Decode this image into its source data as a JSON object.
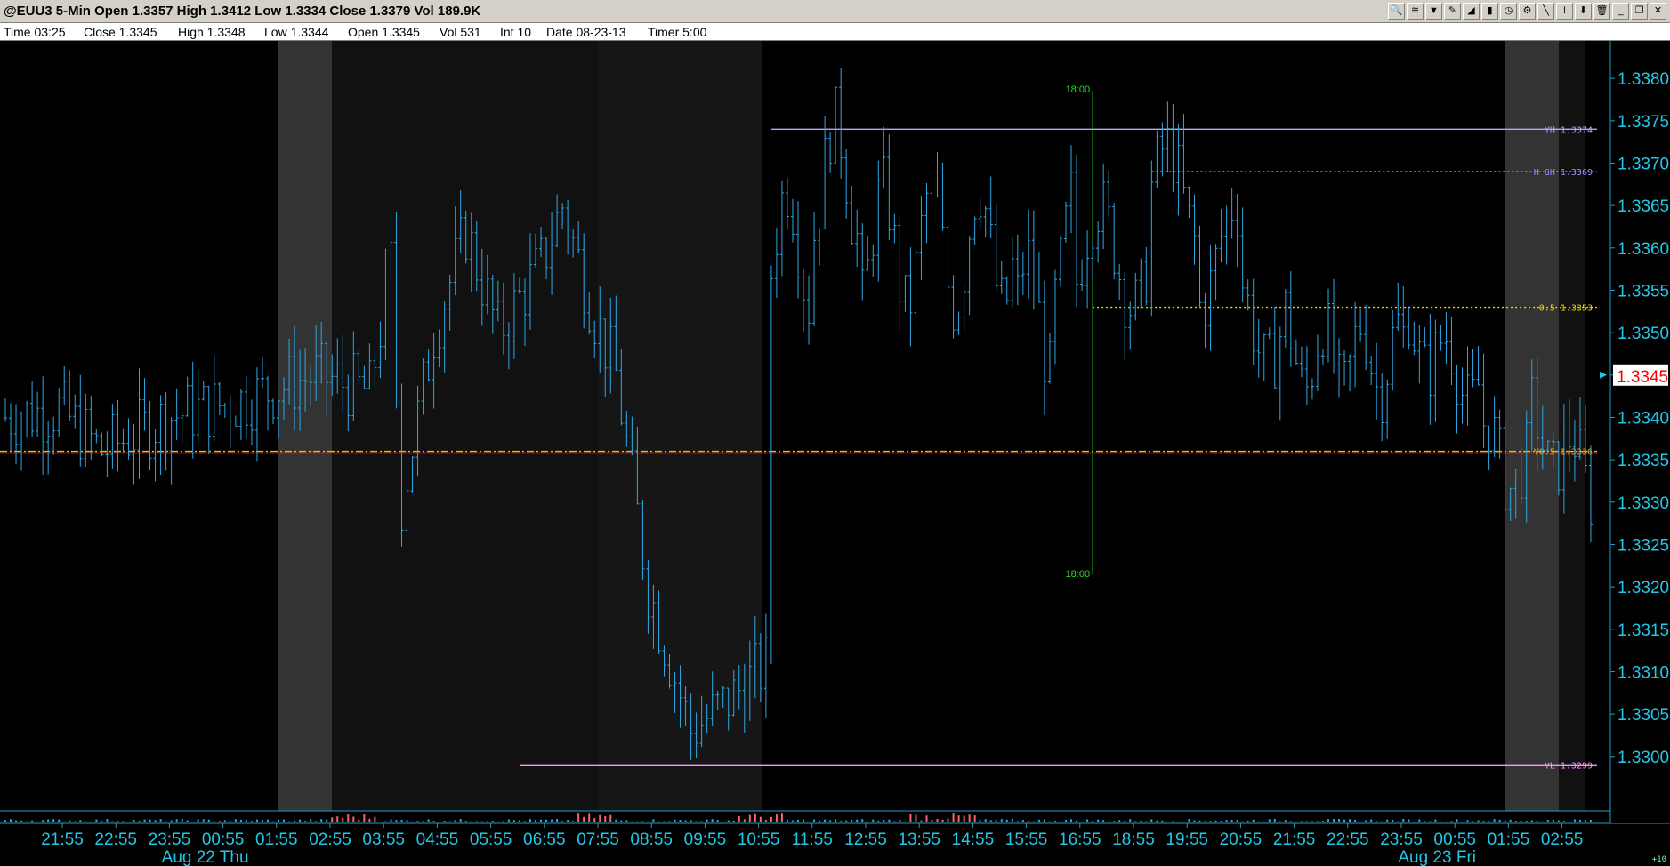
{
  "window": {
    "title": "@EUU3 5-Min Open 1.3357 High 1.3412 Low 1.3334 Close 1.3379 Vol 189.9K",
    "toolbar_icons": [
      "zoom-icon",
      "chart-type-icon",
      "draw-tool-icon",
      "pencil-icon",
      "ruler-icon",
      "bar-icon",
      "clock-icon",
      "settings-icon",
      "wrench-icon",
      "alert-icon",
      "arrow-down-icon",
      "trash-icon",
      "minimize-icon",
      "restore-icon",
      "close-icon"
    ]
  },
  "infobar": {
    "time": "Time 03:25",
    "close": "Close 1.3345",
    "high": "High 1.3348",
    "low": "Low 1.3344",
    "open": "Open 1.3345",
    "vol": "Vol 531",
    "int": "Int 10",
    "date": "Date 08-23-13",
    "timer": "Timer 5:00"
  },
  "corner_label": "+10",
  "chart_data": {
    "type": "bar",
    "ylim": [
      1.3294,
      1.3384
    ],
    "y_ticks": [
      "1.3300",
      "1.3305",
      "1.3310",
      "1.3315",
      "1.3320",
      "1.3325",
      "1.3330",
      "1.3335",
      "1.3340",
      "1.3345",
      "1.3350",
      "1.3355",
      "1.3360",
      "1.3365",
      "1.3370",
      "1.3375",
      "1.3380"
    ],
    "x_ticks": [
      "21:55",
      "22:55",
      "23:55",
      "00:55",
      "01:55",
      "02:55",
      "03:55",
      "04:55",
      "05:55",
      "06:55",
      "07:55",
      "08:55",
      "09:55",
      "10:55",
      "11:55",
      "12:55",
      "13:55",
      "14:55",
      "15:55",
      "16:55",
      "18:55",
      "19:55",
      "20:55",
      "21:55",
      "22:55",
      "23:55",
      "00:55",
      "01:55",
      "02:55"
    ],
    "date_labels": [
      {
        "text": "Aug 22 Thu",
        "at_tick": 3
      },
      {
        "text": "Aug 23 Fri",
        "at_tick": 26
      }
    ],
    "last_price": "1.3345",
    "session_markers": [
      {
        "label": "18:00",
        "at_bar": 203
      }
    ],
    "levels": [
      {
        "label": "YH 1.3374",
        "value": 1.3374,
        "color": "#b4a6ff",
        "style": "solid",
        "from_bar": 143
      },
      {
        "label": "H GH 1.3369",
        "value": 1.3369,
        "color": "#9c8cff",
        "style": "dotted",
        "from_bar": 214
      },
      {
        "label": "0.5 1.3353",
        "value": 1.3353,
        "color": "#e8d800",
        "style": "dotted",
        "from_bar": 203
      },
      {
        "label": "Y0.5 1.3336",
        "value": 1.3336,
        "color": "#e8c000",
        "style": "dashdot",
        "from_bar": 0
      },
      {
        "label": "",
        "value": 1.33358,
        "color": "#ff2020",
        "style": "solid",
        "from_bar": 0
      },
      {
        "label": "YL 1.3299",
        "value": 1.3299,
        "color": "#ff90ff",
        "style": "solid",
        "from_bar": 96
      }
    ],
    "bar_count": 297,
    "keypoints": [
      [
        0,
        1.334
      ],
      [
        10,
        1.3341
      ],
      [
        18,
        1.3336
      ],
      [
        30,
        1.334
      ],
      [
        44,
        1.3342
      ],
      [
        58,
        1.3345
      ],
      [
        68,
        1.3343
      ],
      [
        72,
        1.3358
      ],
      [
        74,
        1.333
      ],
      [
        80,
        1.335
      ],
      [
        86,
        1.3362
      ],
      [
        92,
        1.335
      ],
      [
        100,
        1.3358
      ],
      [
        104,
        1.3365
      ],
      [
        110,
        1.3352
      ],
      [
        114,
        1.3345
      ],
      [
        120,
        1.332
      ],
      [
        128,
        1.3303
      ],
      [
        134,
        1.3306
      ],
      [
        144,
        1.3312
      ],
      [
        156,
        1.3322
      ],
      [
        166,
        1.3342
      ],
      [
        172,
        1.335
      ],
      [
        178,
        1.3338
      ],
      [
        188,
        1.3348
      ],
      [
        198,
        1.3332
      ],
      [
        204,
        1.333
      ],
      [
        216,
        1.3348
      ],
      [
        240,
        1.3347
      ],
      [
        300,
        1.3347
      ]
    ],
    "volume": "shown"
  }
}
